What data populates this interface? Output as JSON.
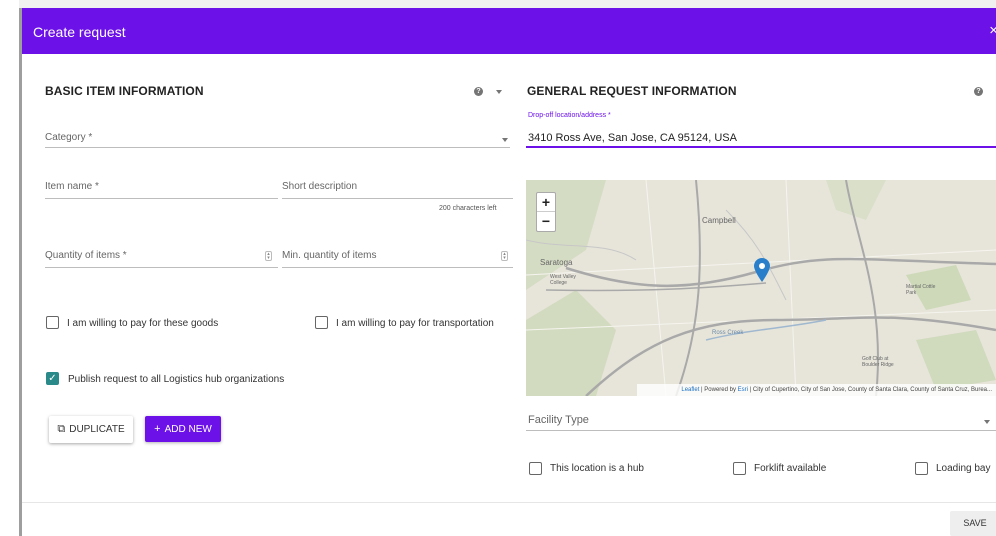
{
  "dialog": {
    "title": "Create request",
    "close_glyph": "×"
  },
  "basic": {
    "section_title": "BASIC ITEM INFORMATION",
    "help_glyph": "?",
    "category_label": "Category *",
    "item_name_label": "Item name *",
    "short_description_label": "Short description",
    "characters_left": "200 characters left",
    "quantity_label": "Quantity of items *",
    "min_quantity_label": "Min. quantity of items",
    "pay_goods_label": "I am willing to pay for these goods",
    "pay_goods_checked": false,
    "pay_transport_label": "I am willing to pay for transportation",
    "pay_transport_checked": false,
    "publish_label": "Publish request to all Logistics hub organizations",
    "publish_checked": true,
    "duplicate_label": "DUPLICATE",
    "add_new_label": "ADD NEW",
    "duplicate_icon": "copy-icon",
    "add_icon": "plus-icon"
  },
  "general": {
    "section_title": "GENERAL REQUEST INFORMATION",
    "help_glyph": "?",
    "dropoff_label": "Drop-off location/address *",
    "dropoff_value": "3410 Ross Ave, San Jose, CA 95124, USA",
    "facility_type_label": "Facility Type",
    "hub_label": "This location is a hub",
    "hub_checked": false,
    "forklift_label": "Forklift available",
    "forklift_checked": false,
    "loading_bay_label": "Loading bay",
    "loading_bay_checked": false
  },
  "map": {
    "zoom_in": "+",
    "zoom_out": "−",
    "place_campbell": "Campbell",
    "place_saratoga": "Saratoga",
    "place_west_valley": "West Valley College",
    "place_martial": "Martial Cottle Park",
    "place_golf": "Golf Club at Boulder Ridge",
    "road_ross_creek": "Ross Creek",
    "attribution_leaflet": "Leaflet",
    "attribution_powered": "| Powered by",
    "attribution_esri": "Esri",
    "attribution_text": "| City of Cupertino, City of San Jose, County of Santa Clara, County of Santa Cruz, Burea...",
    "marker_icon": "map-pin-icon",
    "marker_color": "#2a7fcb"
  },
  "footer": {
    "save_label": "SAVE"
  },
  "colors": {
    "accent": "#6c11e8",
    "checkbox_checked": "#2a8a89"
  }
}
